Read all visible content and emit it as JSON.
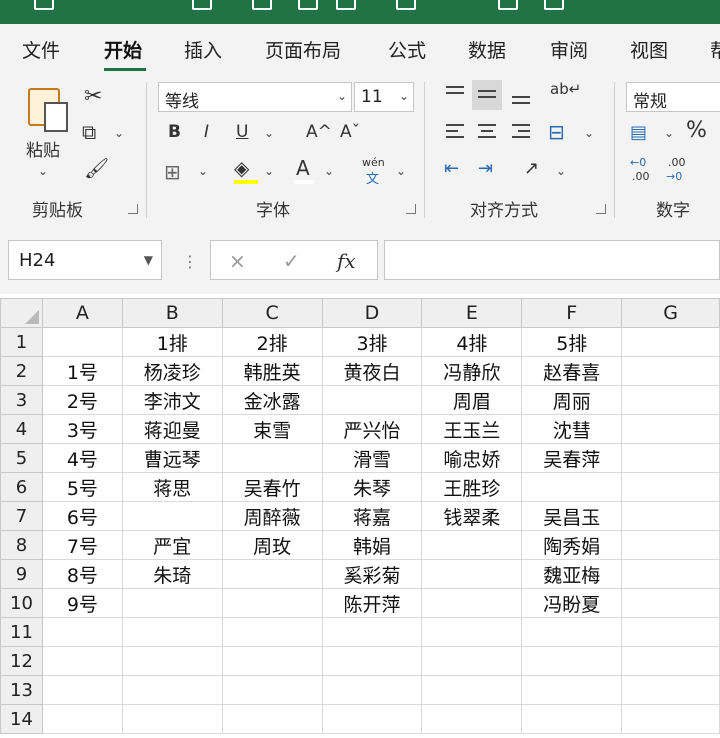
{
  "ribbon_tabs": [
    "文件",
    "开始",
    "插入",
    "页面布局",
    "公式",
    "数据",
    "审阅",
    "视图",
    "帮"
  ],
  "active_tab": "开始",
  "ribbon": {
    "paste_label": "粘贴",
    "clipboard_group": "剪贴板",
    "font_group": "字体",
    "font_name": "等线",
    "font_size": "11",
    "bold": "B",
    "italic": "I",
    "underline": "U",
    "grow_font": "A^",
    "shrink_font": "Aˇ",
    "font_color": "A",
    "phonetic": "wén",
    "phonetic_sub": "文",
    "align_group": "对齐方式",
    "number_format": "常规",
    "number_group": "数字",
    "percent": "%",
    "inc_decimal_top": "←0",
    "inc_decimal_bottom": ".00",
    "dec_decimal_top": ".00",
    "dec_decimal_bottom": "→0"
  },
  "formula_bar": {
    "name_box": "H24",
    "cancel": "×",
    "enter": "✓",
    "fx": "fx",
    "formula": ""
  },
  "sheet": {
    "columns": [
      "A",
      "B",
      "C",
      "D",
      "E",
      "F",
      "G"
    ],
    "rows": [
      {
        "n": "1",
        "cells": [
          "",
          "1排",
          "2排",
          "3排",
          "4排",
          "5排",
          ""
        ]
      },
      {
        "n": "2",
        "cells": [
          "1号",
          "杨凌珍",
          "韩胜英",
          "黄夜白",
          "冯静欣",
          "赵春喜",
          ""
        ]
      },
      {
        "n": "3",
        "cells": [
          "2号",
          "李沛文",
          "金冰露",
          "",
          "周眉",
          "周丽",
          ""
        ]
      },
      {
        "n": "4",
        "cells": [
          "3号",
          "蒋迎曼",
          "束雪",
          "严兴怡",
          "王玉兰",
          "沈彗",
          ""
        ]
      },
      {
        "n": "5",
        "cells": [
          "4号",
          "曹远琴",
          "",
          "滑雪",
          "喻忠娇",
          "吴春萍",
          ""
        ]
      },
      {
        "n": "6",
        "cells": [
          "5号",
          "蒋思",
          "吴春竹",
          "朱琴",
          "王胜珍",
          "",
          ""
        ]
      },
      {
        "n": "7",
        "cells": [
          "6号",
          "",
          "周醉薇",
          "蒋嘉",
          "钱翠柔",
          "吴昌玉",
          ""
        ]
      },
      {
        "n": "8",
        "cells": [
          "7号",
          "严宜",
          "周玫",
          "韩娟",
          "",
          "陶秀娟",
          ""
        ]
      },
      {
        "n": "9",
        "cells": [
          "8号",
          "朱琦",
          "",
          "奚彩菊",
          "",
          "魏亚梅",
          ""
        ]
      },
      {
        "n": "10",
        "cells": [
          "9号",
          "",
          "",
          "陈开萍",
          "",
          "冯盼夏",
          ""
        ]
      },
      {
        "n": "11",
        "cells": [
          "",
          "",
          "",
          "",
          "",
          "",
          ""
        ]
      },
      {
        "n": "12",
        "cells": [
          "",
          "",
          "",
          "",
          "",
          "",
          ""
        ]
      },
      {
        "n": "13",
        "cells": [
          "",
          "",
          "",
          "",
          "",
          "",
          ""
        ]
      },
      {
        "n": "14",
        "cells": [
          "",
          "",
          "",
          "",
          "",
          "",
          ""
        ]
      }
    ]
  },
  "colors": {
    "brand": "#217346",
    "ribbon_bg": "#f3f3f3",
    "header_bg": "#efefef",
    "gridline": "#d9d9d9"
  }
}
